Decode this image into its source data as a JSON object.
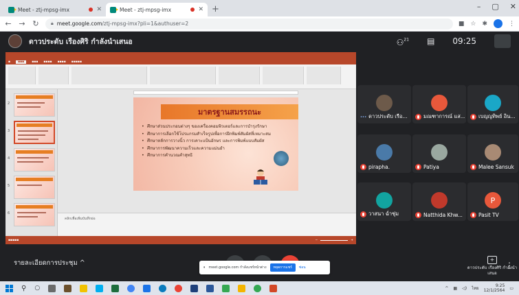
{
  "browser": {
    "tabs": [
      {
        "title": "Meet - ztj-mpsg-imx",
        "active": false
      },
      {
        "title": "Meet - ztj-mpsg-imx",
        "active": true
      }
    ],
    "url_host": "meet.google.com",
    "url_path": "/ztj-mpsg-imx?pli=1&authuser=2"
  },
  "meet": {
    "presenter_title": "ดาวประดับ เรืองศิริ กำลังนำเสนอ",
    "participant_count": "21",
    "time": "09:25",
    "meeting_details": "รายละเอียดการประชุม",
    "share_text": "meet.google.com กำลังแชร์หน้าต่าง",
    "stop_sharing": "หยุดการแชร์",
    "hide": "ซ่อน",
    "presenting_label": "ดาวประดับ เรืองศิริ กำลังนำเสนอ"
  },
  "slide": {
    "heading": "มาตรฐานสมรรถนะ",
    "bullets": [
      "ศึกษาส่วนประกอบต่างๆ ของเครื่องคอมพิวเตอร์และการบำรุงรักษา",
      "ศึกษาการเลือกใช้โปรแกรมสำเร็จรูปเพื่อการฝึกพิมพ์สัมผัสที่เหมาะสม",
      "ศึกษาหลักการวางนิ้ว การเคาะแป้นอักษร และการพิมพ์แบบสัมผัส",
      "ศึกษาการพัฒนาความเร็วและความแม่นยำ",
      "ศึกษาการคำนวณคำสุทธิ"
    ],
    "notes": "คลิกเพื่อเพิ่มบันทึกย่อ"
  },
  "participants": [
    {
      "name": "ดาวประดับ เรือ...",
      "avatar": "",
      "color": "#6d5a4a",
      "mic_off": false,
      "speaking": true
    },
    {
      "name": "มณฑาการณ์ แส...",
      "avatar": "",
      "color": "#e8583b",
      "mic_off": true,
      "speaking": false
    },
    {
      "name": "เบญญทิพย์ อิน...",
      "avatar": "",
      "color": "#1aa7c7",
      "mic_off": true,
      "speaking": false
    },
    {
      "name": "pirapha.",
      "avatar": "",
      "color": "#4a7aa8",
      "mic_off": true,
      "speaking": false
    },
    {
      "name": "Patiya",
      "avatar": "",
      "color": "#9aa8a0",
      "mic_off": true,
      "speaking": false
    },
    {
      "name": "Malee Sansuk",
      "avatar": "",
      "color": "#a88a74",
      "mic_off": true,
      "speaking": false
    },
    {
      "name": "วาสนา ฉ่ำชุ่ม",
      "avatar": "",
      "color": "#12a4a0",
      "mic_off": true,
      "speaking": false
    },
    {
      "name": "Natthida Khw...",
      "avatar": "",
      "color": "#c0392b",
      "mic_off": true,
      "speaking": false
    },
    {
      "name": "Pasit TV",
      "avatar": "P",
      "color": "#e8583b",
      "mic_off": true,
      "speaking": false
    }
  ],
  "tray": {
    "lang": "ไทย",
    "time": "9:25",
    "date": "12/1/2564"
  }
}
